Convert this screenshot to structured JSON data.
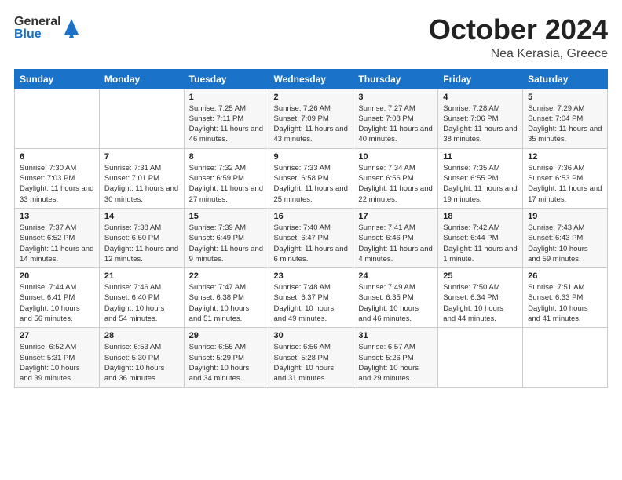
{
  "header": {
    "logo_general": "General",
    "logo_blue": "Blue",
    "title": "October 2024",
    "location": "Nea Kerasia, Greece"
  },
  "weekdays": [
    "Sunday",
    "Monday",
    "Tuesday",
    "Wednesday",
    "Thursday",
    "Friday",
    "Saturday"
  ],
  "weeks": [
    [
      {
        "day": "",
        "info": ""
      },
      {
        "day": "",
        "info": ""
      },
      {
        "day": "1",
        "info": "Sunrise: 7:25 AM\nSunset: 7:11 PM\nDaylight: 11 hours and 46 minutes."
      },
      {
        "day": "2",
        "info": "Sunrise: 7:26 AM\nSunset: 7:09 PM\nDaylight: 11 hours and 43 minutes."
      },
      {
        "day": "3",
        "info": "Sunrise: 7:27 AM\nSunset: 7:08 PM\nDaylight: 11 hours and 40 minutes."
      },
      {
        "day": "4",
        "info": "Sunrise: 7:28 AM\nSunset: 7:06 PM\nDaylight: 11 hours and 38 minutes."
      },
      {
        "day": "5",
        "info": "Sunrise: 7:29 AM\nSunset: 7:04 PM\nDaylight: 11 hours and 35 minutes."
      }
    ],
    [
      {
        "day": "6",
        "info": "Sunrise: 7:30 AM\nSunset: 7:03 PM\nDaylight: 11 hours and 33 minutes."
      },
      {
        "day": "7",
        "info": "Sunrise: 7:31 AM\nSunset: 7:01 PM\nDaylight: 11 hours and 30 minutes."
      },
      {
        "day": "8",
        "info": "Sunrise: 7:32 AM\nSunset: 6:59 PM\nDaylight: 11 hours and 27 minutes."
      },
      {
        "day": "9",
        "info": "Sunrise: 7:33 AM\nSunset: 6:58 PM\nDaylight: 11 hours and 25 minutes."
      },
      {
        "day": "10",
        "info": "Sunrise: 7:34 AM\nSunset: 6:56 PM\nDaylight: 11 hours and 22 minutes."
      },
      {
        "day": "11",
        "info": "Sunrise: 7:35 AM\nSunset: 6:55 PM\nDaylight: 11 hours and 19 minutes."
      },
      {
        "day": "12",
        "info": "Sunrise: 7:36 AM\nSunset: 6:53 PM\nDaylight: 11 hours and 17 minutes."
      }
    ],
    [
      {
        "day": "13",
        "info": "Sunrise: 7:37 AM\nSunset: 6:52 PM\nDaylight: 11 hours and 14 minutes."
      },
      {
        "day": "14",
        "info": "Sunrise: 7:38 AM\nSunset: 6:50 PM\nDaylight: 11 hours and 12 minutes."
      },
      {
        "day": "15",
        "info": "Sunrise: 7:39 AM\nSunset: 6:49 PM\nDaylight: 11 hours and 9 minutes."
      },
      {
        "day": "16",
        "info": "Sunrise: 7:40 AM\nSunset: 6:47 PM\nDaylight: 11 hours and 6 minutes."
      },
      {
        "day": "17",
        "info": "Sunrise: 7:41 AM\nSunset: 6:46 PM\nDaylight: 11 hours and 4 minutes."
      },
      {
        "day": "18",
        "info": "Sunrise: 7:42 AM\nSunset: 6:44 PM\nDaylight: 11 hours and 1 minute."
      },
      {
        "day": "19",
        "info": "Sunrise: 7:43 AM\nSunset: 6:43 PM\nDaylight: 10 hours and 59 minutes."
      }
    ],
    [
      {
        "day": "20",
        "info": "Sunrise: 7:44 AM\nSunset: 6:41 PM\nDaylight: 10 hours and 56 minutes."
      },
      {
        "day": "21",
        "info": "Sunrise: 7:46 AM\nSunset: 6:40 PM\nDaylight: 10 hours and 54 minutes."
      },
      {
        "day": "22",
        "info": "Sunrise: 7:47 AM\nSunset: 6:38 PM\nDaylight: 10 hours and 51 minutes."
      },
      {
        "day": "23",
        "info": "Sunrise: 7:48 AM\nSunset: 6:37 PM\nDaylight: 10 hours and 49 minutes."
      },
      {
        "day": "24",
        "info": "Sunrise: 7:49 AM\nSunset: 6:35 PM\nDaylight: 10 hours and 46 minutes."
      },
      {
        "day": "25",
        "info": "Sunrise: 7:50 AM\nSunset: 6:34 PM\nDaylight: 10 hours and 44 minutes."
      },
      {
        "day": "26",
        "info": "Sunrise: 7:51 AM\nSunset: 6:33 PM\nDaylight: 10 hours and 41 minutes."
      }
    ],
    [
      {
        "day": "27",
        "info": "Sunrise: 6:52 AM\nSunset: 5:31 PM\nDaylight: 10 hours and 39 minutes."
      },
      {
        "day": "28",
        "info": "Sunrise: 6:53 AM\nSunset: 5:30 PM\nDaylight: 10 hours and 36 minutes."
      },
      {
        "day": "29",
        "info": "Sunrise: 6:55 AM\nSunset: 5:29 PM\nDaylight: 10 hours and 34 minutes."
      },
      {
        "day": "30",
        "info": "Sunrise: 6:56 AM\nSunset: 5:28 PM\nDaylight: 10 hours and 31 minutes."
      },
      {
        "day": "31",
        "info": "Sunrise: 6:57 AM\nSunset: 5:26 PM\nDaylight: 10 hours and 29 minutes."
      },
      {
        "day": "",
        "info": ""
      },
      {
        "day": "",
        "info": ""
      }
    ]
  ]
}
